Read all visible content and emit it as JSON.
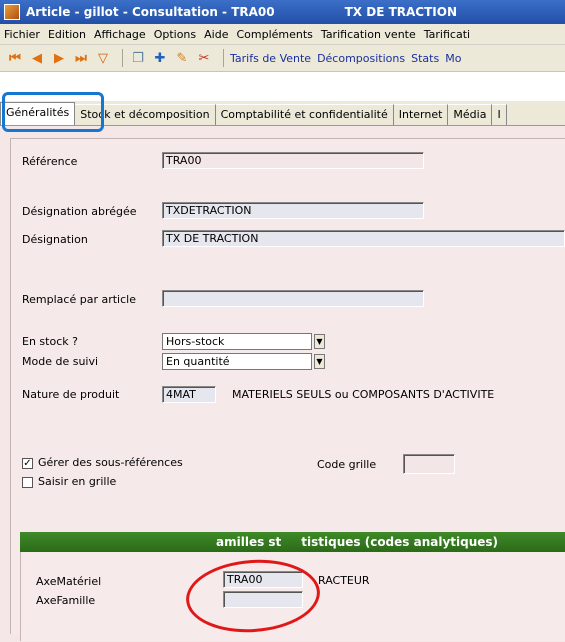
{
  "window": {
    "title": "Article - gillot - Consultation - TRA00",
    "title_right": "TX DE TRACTION"
  },
  "menu": [
    "Fichier",
    "Edition",
    "Affichage",
    "Options",
    "Aide",
    "Compléments",
    "Tarification vente",
    "Tarificati"
  ],
  "toolbar": {
    "links": [
      "Tarifs de Vente",
      "Décompositions",
      "Stats",
      "Mo"
    ]
  },
  "tabs": [
    "Généralités",
    "Stock et décomposition",
    "Comptabilité et confidentialité",
    "Internet",
    "Média",
    "I"
  ],
  "form": {
    "reference_label": "Référence",
    "reference_value": "TRA00",
    "designation_abregee_label": "Désignation abrégée",
    "designation_abregee_value": "TXDETRACTION",
    "designation_label": "Désignation",
    "designation_value": "TX DE TRACTION",
    "remplace_label": "Remplacé par article",
    "remplace_value": "",
    "en_stock_label": "En stock ?",
    "en_stock_value": "Hors-stock",
    "mode_suivi_label": "Mode de suivi",
    "mode_suivi_value": "En quantité",
    "nature_label": "Nature de produit",
    "nature_value": "4MAT",
    "nature_desc": "MATERIELS SEULS ou COMPOSANTS D'ACTIVITE",
    "gerer_label": "Gérer des sous-références",
    "gerer_checked": true,
    "saisir_label": "Saisir en grille",
    "saisir_checked": false,
    "code_grille_label": "Code grille",
    "code_grille_value": ""
  },
  "group": {
    "header_left": "",
    "header_middle": "amilles st",
    "header_right": "tistiques (codes analytiques)",
    "axe_materiel_label": "AxeMatériel",
    "axe_materiel_value": "TRA00",
    "axe_materiel_desc": "RACTEUR",
    "axe_famille_label": "AxeFamille",
    "axe_famille_value": ""
  },
  "colors": {
    "title_bg": "#2350a8",
    "group_header_bg": "#2c6a18",
    "panel_bg": "#f5e7e7",
    "highlight_blue": "#1677d2",
    "highlight_red": "#e01818"
  }
}
